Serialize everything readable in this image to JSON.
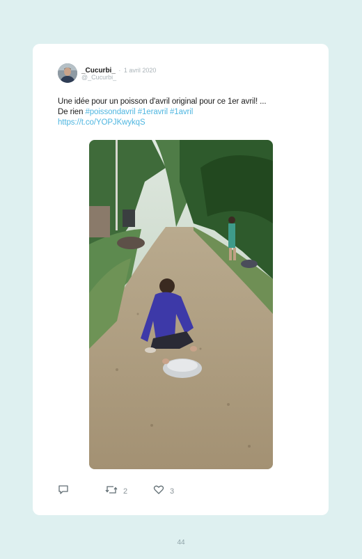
{
  "tweet": {
    "author_name": "_Cucurbi_",
    "separator": "·",
    "date": "1 avril 2020",
    "handle": "@_Cucurbi_",
    "text_line1": "Une idée pour un poisson d'avril original pour ce 1er avril! ...",
    "text_line2_prefix": "De rien ",
    "hashtags": [
      "#poissondavril",
      "#1eravril",
      "#1avril"
    ],
    "link": "https://t.co/YOPJKwykqS",
    "media": {
      "type": "video",
      "qr_code": true
    },
    "actions": {
      "reply": {
        "icon": "reply-icon"
      },
      "retweet": {
        "icon": "retweet-icon",
        "count": "2"
      },
      "like": {
        "icon": "heart-icon",
        "count": "3"
      }
    }
  },
  "page_number": "44",
  "colors": {
    "background": "#def0f0",
    "card": "#ffffff",
    "link": "#4fb6e0",
    "muted": "#aab3b8"
  }
}
